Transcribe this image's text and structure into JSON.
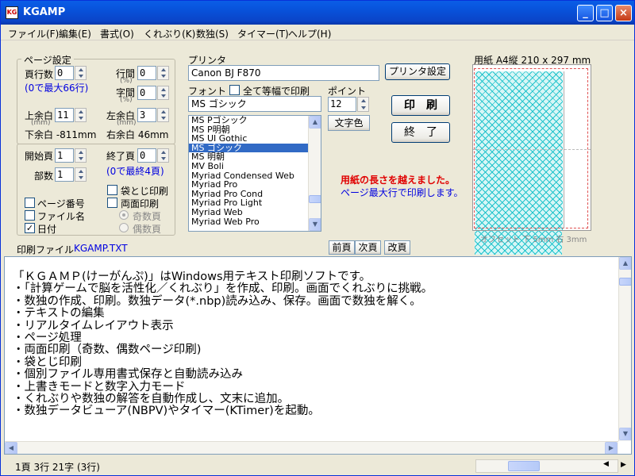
{
  "window": {
    "icon_text": "KG",
    "title": "KGAMP"
  },
  "menu": [
    {
      "label": "ファイル(F)"
    },
    {
      "label": "編集(E)"
    },
    {
      "label": "書式(O)"
    },
    {
      "label": "くれぶり(K)"
    },
    {
      "label": "数独(S)"
    },
    {
      "label": "タイマー(T)"
    },
    {
      "label": "ヘルプ(H)"
    }
  ],
  "page_settings": {
    "group_title": "ページ設定",
    "lines_per_page": {
      "label": "頁行数",
      "value": "0"
    },
    "lines_hint": "(0で最大66行)",
    "line_spacing": {
      "label": "行間",
      "unit": "(%)",
      "value": "0"
    },
    "char_spacing": {
      "label": "字間",
      "unit": "(%)",
      "value": "0"
    },
    "top_margin": {
      "label": "上余白",
      "unit": "(mm)",
      "value": "11"
    },
    "left_margin": {
      "label": "左余白",
      "unit": "(mm)",
      "value": "3"
    },
    "bottom_margin": "下余白 -811mm",
    "right_margin": "右余白 46mm"
  },
  "pages": {
    "start": {
      "label": "開始頁",
      "value": "1"
    },
    "end": {
      "label": "終了頁",
      "value": "0"
    },
    "copies": {
      "label": "部数",
      "value": "1"
    },
    "end_hint": "(0で最終4頁)",
    "fukuro": {
      "label": "袋とじ印刷",
      "checked": false
    },
    "page_number": {
      "label": "ページ番号",
      "checked": false
    },
    "duplex": {
      "label": "両面印刷",
      "checked": false
    },
    "filename": {
      "label": "ファイル名",
      "checked": false
    },
    "odd": {
      "label": "奇数頁",
      "selected": true
    },
    "date": {
      "label": "日付",
      "checked": true
    },
    "even": {
      "label": "偶数頁",
      "selected": false
    }
  },
  "print_file": {
    "label": "印刷ファイル",
    "value": "KGAMP.TXT"
  },
  "printer": {
    "label": "プリンタ",
    "name": "Canon BJ F870",
    "settings_button": "プリンタ設定",
    "font_label": "フォント",
    "monospace_all": {
      "label": "全て等幅で印刷",
      "checked": false
    },
    "point_label": "ポイント",
    "font_value": "MS ゴシック",
    "point_value": "12",
    "char_color_button": "文字色",
    "print_button": "印　刷",
    "exit_button": "終　了",
    "fonts": [
      "MS Pゴシック",
      "MS P明朝",
      "MS UI Gothic",
      "MS ゴシック",
      "MS 明朝",
      "MV Boli",
      "Myriad Condensed Web",
      "Myriad Pro",
      "Myriad Pro Cond",
      "Myriad Pro Light",
      "Myriad Web",
      "Myriad Web Pro"
    ],
    "selected_font_index": 3,
    "warning": "用紙の長さを越えました。",
    "info": "ページ最大行で印刷します。",
    "prev_page": "前頁",
    "next_page": "次頁",
    "page_break": "改頁"
  },
  "preview": {
    "paper_label": "用紙 A4縦 210 x 297 mm",
    "offset_label": "オフセット 下 5mm 右 3mm"
  },
  "editor": {
    "lines": [
      "「ＫＧＡＭＰ(けーがんぷ)」はWindows用テキスト印刷ソフトです。",
      "・「計算ゲームで脳を活性化／くれぶり」を作成、印刷。画面でくれぶりに挑戦。",
      "・数独の作成、印刷。数独データ(*.nbp)読み込み、保存。画面で数独を解く。",
      "・テキストの編集",
      "・リアルタイムレイアウト表示",
      "・ページ処理",
      "・両面印刷（奇数、偶数ページ印刷)",
      "・袋とじ印刷",
      "・個別ファイル専用書式保存と自動読み込み",
      "・上書きモードと数字入力モード",
      "・くれぶりや数独の解答を自動作成し、文末に追加。",
      "・数独データビューア(NBPV)やタイマー(KTimer)を起動。"
    ]
  },
  "status": {
    "text": "1頁 3行 21字 (3行)"
  }
}
